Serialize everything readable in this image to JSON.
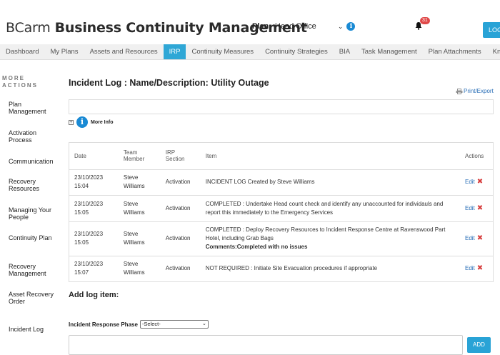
{
  "header": {
    "brand_left": "BCarm",
    "brand_right": "Business Continuity Management",
    "plan_label": "Plan:",
    "plan_value": "Head Office",
    "notification_count": "31",
    "login_label": "LOG"
  },
  "nav": {
    "items": [
      "Dashboard",
      "My Plans",
      "Assets and Resources",
      "IRP",
      "Continuity Measures",
      "Continuity Strategies",
      "BIA",
      "Task Management",
      "Plan Attachments",
      "Knowled"
    ],
    "active": "IRP"
  },
  "sidebar": {
    "heading": "MORE ACTIONS",
    "items": [
      "Plan Management",
      "Activation Process",
      "Communication",
      "Recovery Resources",
      "Managing Your People",
      "Continuity Plan",
      "Recovery Management",
      "Asset Recovery Order",
      "Incident Log"
    ]
  },
  "main": {
    "title": "Incident Log : Name/Description: Utility Outage",
    "print_label": "Print/Export",
    "more_info_label": "More Info",
    "table": {
      "headers": {
        "date": "Date",
        "member": "Team Member",
        "section": "IRP Section",
        "item": "Item",
        "actions": "Actions"
      },
      "edit_label": "Edit",
      "rows": [
        {
          "date": "23/10/2023 15:04",
          "member": "Steve Williams",
          "section": "Activation",
          "item": "INCIDENT LOG Created by Steve Williams",
          "comments": ""
        },
        {
          "date": "23/10/2023 15:05",
          "member": "Steve Williams",
          "section": "Activation",
          "item": "COMPLETED : Undertake Head count check and identify any unaccounted for individauls and report this immediately to the Emergency Services",
          "comments": ""
        },
        {
          "date": "23/10/2023 15:05",
          "member": "Steve Williams",
          "section": "Activation",
          "item": "COMPLETED : Deploy Recovery Resources to Incident Response Centre at Ravenswood Part Hotel, including Grab Bags",
          "comments": "Comments:Completed with no issues"
        },
        {
          "date": "23/10/2023 15:07",
          "member": "Steve Williams",
          "section": "Activation",
          "item": "NOT REQUIRED : Initiate Site Evacuation procedures if appropriate",
          "comments": ""
        }
      ]
    },
    "add_title": "Add log item:",
    "phase_label": "Incident Response Phase",
    "phase_value": "-Select-",
    "add_button": "ADD"
  },
  "colors": {
    "accent": "#2fa7d6",
    "link": "#2a6fb7",
    "delete": "#d63b3b",
    "badge": "#e04848"
  }
}
